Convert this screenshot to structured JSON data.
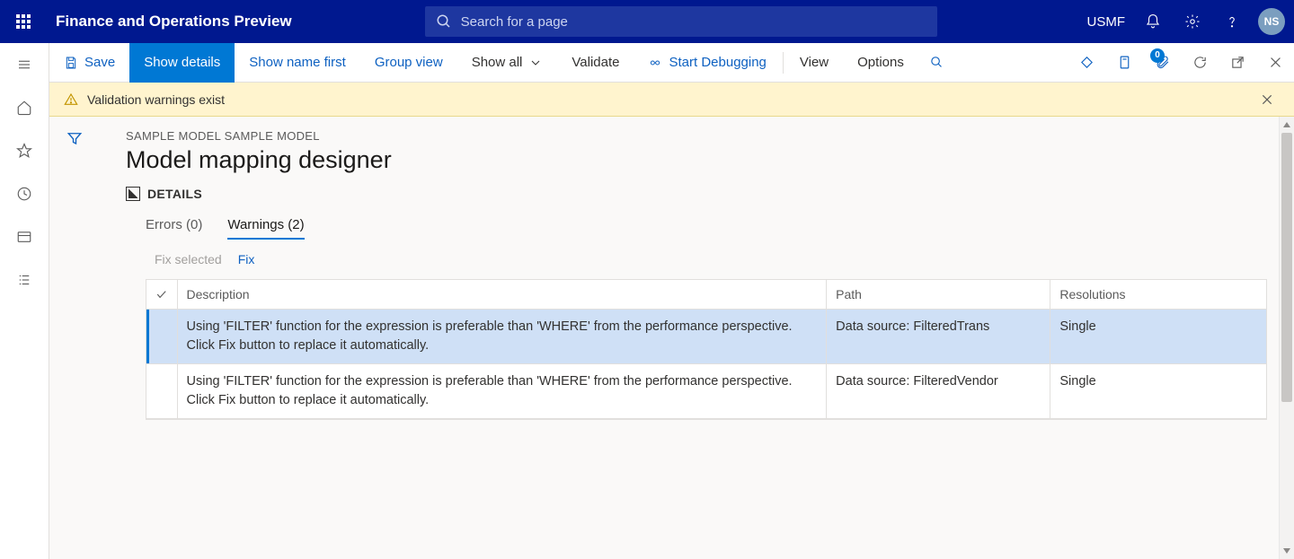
{
  "header": {
    "app_title": "Finance and Operations Preview",
    "search_placeholder": "Search for a page",
    "company_code": "USMF",
    "avatar_initials": "NS"
  },
  "actionbar": {
    "save": "Save",
    "show_details": "Show details",
    "show_name_first": "Show name first",
    "group_view": "Group view",
    "show_all": "Show all",
    "validate": "Validate",
    "start_debugging": "Start Debugging",
    "view": "View",
    "options": "Options",
    "badge_count": "0"
  },
  "banner": {
    "message": "Validation warnings exist"
  },
  "page": {
    "breadcrumb": "SAMPLE MODEL SAMPLE MODEL",
    "title": "Model mapping designer",
    "section_label": "DETAILS"
  },
  "tabs": {
    "errors": {
      "label": "Errors (0)",
      "active": false
    },
    "warnings": {
      "label": "Warnings (2)",
      "active": true
    }
  },
  "subactions": {
    "fix_selected": "Fix selected",
    "fix": "Fix"
  },
  "grid": {
    "columns": {
      "description": "Description",
      "path": "Path",
      "resolutions": "Resolutions"
    },
    "rows": [
      {
        "description": "Using 'FILTER' function for the expression is preferable than 'WHERE' from the performance perspective. Click Fix button to replace it automatically.",
        "path": "Data source: FilteredTrans",
        "resolutions": "Single",
        "selected": true
      },
      {
        "description": "Using 'FILTER' function for the expression is preferable than 'WHERE' from the performance perspective. Click Fix button to replace it automatically.",
        "path": "Data source: FilteredVendor",
        "resolutions": "Single",
        "selected": false
      }
    ]
  }
}
